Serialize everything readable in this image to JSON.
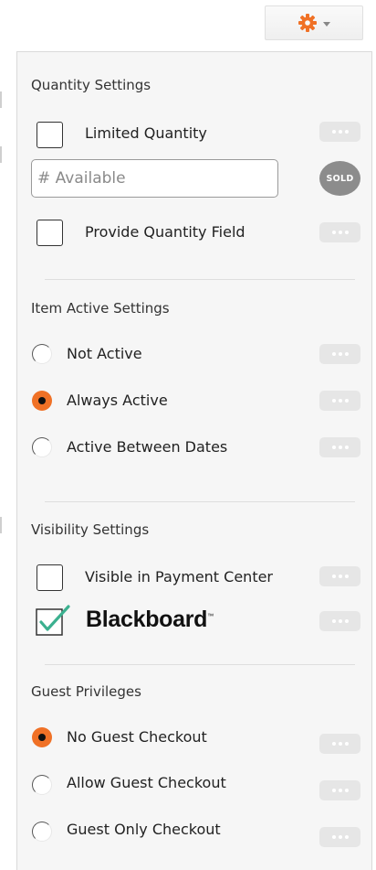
{
  "header": {
    "settings_icon": "gear-icon",
    "accent_color": "#f07126"
  },
  "quantity": {
    "title": "Quantity Settings",
    "limited_label": "Limited Quantity",
    "limited_checked": false,
    "available_placeholder": "# Available",
    "available_value": "",
    "sold_label": "SOLD",
    "provide_field_label": "Provide Quantity Field",
    "provide_field_checked": false
  },
  "active": {
    "title": "Item Active Settings",
    "options": [
      {
        "label": "Not Active",
        "checked": false
      },
      {
        "label": "Always Active",
        "checked": true
      },
      {
        "label": "Active Between Dates",
        "checked": false
      }
    ]
  },
  "visibility": {
    "title": "Visibility Settings",
    "payment_center_label": "Visible in Payment Center",
    "payment_center_checked": false,
    "blackboard_label": "Blackboard",
    "blackboard_checked": true
  },
  "guest": {
    "title": "Guest Privileges",
    "options": [
      {
        "label": "No Guest Checkout",
        "checked": true
      },
      {
        "label": "Allow Guest Checkout",
        "checked": false
      },
      {
        "label": "Guest Only Checkout",
        "checked": false
      }
    ]
  }
}
